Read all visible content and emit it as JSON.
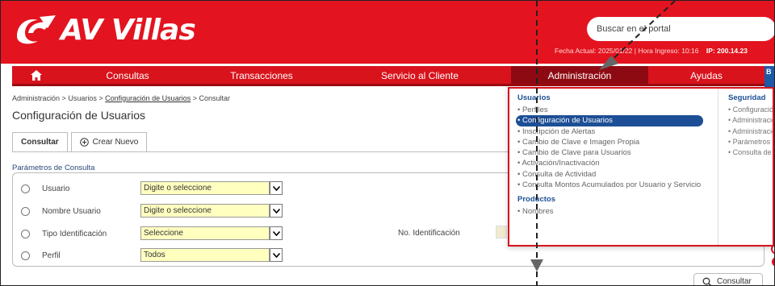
{
  "brand": {
    "name": "AV Villas",
    "accent": "#e3141f",
    "nav_active": "#8e0a12",
    "link_blue": "#1d4f96"
  },
  "header": {
    "search_placeholder": "Buscar en el portal",
    "session_text": "Fecha Actual: 2025/01/22 | Hora Ingreso: 10:16",
    "ip_text": "IP: 200.14.23"
  },
  "nav": {
    "home_icon": "home-icon",
    "items": [
      "Consultas",
      "Transacciones",
      "Servicio al Cliente",
      "Administración",
      "Ayudas"
    ],
    "right_chip": "B"
  },
  "breadcrumb": {
    "a": "Administración",
    "b": "Usuarios",
    "c": "Configuración de Usuarios",
    "d": "Consultar",
    "sep": ">"
  },
  "page": {
    "title": "Configuración de Usuarios",
    "tabs": {
      "consultar": "Consultar",
      "crear": "Crear Nuevo"
    },
    "section": "Parámetros de Consulta",
    "rows": [
      {
        "label": "Usuario",
        "value": "Digite o seleccione"
      },
      {
        "label": "Nombre Usuario",
        "value": "Digite o seleccione"
      },
      {
        "label": "Tipo Identificación",
        "value": "Seleccione"
      },
      {
        "label": "Perfil",
        "value": "Todos"
      }
    ],
    "noid_label": "No. Identificación",
    "consultar_button": "Consultar"
  },
  "dropdown": {
    "usuarios_head": "Usuarios",
    "usuarios": [
      "• Perfiles",
      "• Configuración de Usuarios",
      "• Inscripción de Alertas",
      "• Cambio de Clave e Imagen Propia",
      "• Cambio de Clave para Usuarios",
      "• Activación/Inactivación",
      "• Consulta de Actividad",
      "• Consulta Montos Acumulados por Usuario y Servicio"
    ],
    "productos_head": "Productos",
    "productos": [
      "• Nombres"
    ],
    "seguridad_head": "Seguridad",
    "seguridad": [
      "• Configuración",
      "• Administració",
      "• Administració",
      "• Parámetros G",
      "• Consulta de T"
    ]
  }
}
